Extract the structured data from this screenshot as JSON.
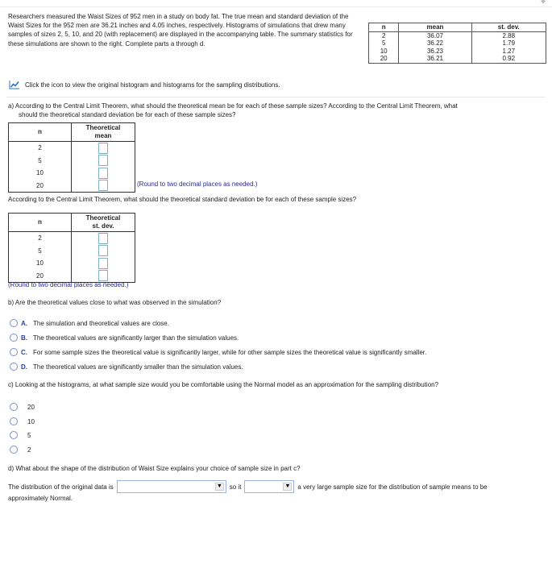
{
  "header": {
    "expand_icon": "expand-icon"
  },
  "intro": {
    "text": "Researchers measured the Waist Sizes of 952 men in a study on body fat. The true mean and standard deviation of the Waist Sizes for the 952 men are 36.21 inches and 4.05 inches, respectively. Histograms of simulations that drew many samples of sizes 2, 5, 10, and 20 (with replacement) are displayed in the accompanying table. The summary statistics for these simulations are shown to the right. Complete parts a through d."
  },
  "summary_table": {
    "headers": [
      "n",
      "mean",
      "st. dev."
    ],
    "rows": [
      [
        "2",
        "36.07",
        "2.88"
      ],
      [
        "5",
        "36.22",
        "1.79"
      ],
      [
        "10",
        "36.23",
        "1.27"
      ],
      [
        "20",
        "36.21",
        "0.92"
      ]
    ]
  },
  "histogram_link": {
    "icon": "chart-icon",
    "text": "Click the icon to view the original histogram and histograms for the sampling distributions."
  },
  "part_a": {
    "question_line1": "a) According to the Central Limit Theorem, what should the theoretical mean be for each of these sample sizes? According to the Central Limit Theorem, what",
    "question_line2": "should the theoretical standard deviation be for each of these sample sizes?",
    "mean_table": {
      "header_n": "n",
      "header_value_line1": "Theoretical",
      "header_value_line2": "mean",
      "n_values": [
        "2",
        "5",
        "10",
        "20"
      ],
      "answers": [
        "",
        "",
        "",
        ""
      ]
    },
    "round_note_1": "(Round to two decimal places as needed.)",
    "sd_question": "According to the Central Limit Theorem, what should the theoretical standard deviation be for each of these sample sizes?",
    "sd_table": {
      "header_n": "n",
      "header_value_line1": "Theoretical",
      "header_value_line2": "st. dev.",
      "n_values": [
        "2",
        "5",
        "10",
        "20"
      ],
      "answers": [
        "",
        "",
        "",
        ""
      ]
    },
    "round_note_2": "(Round to two decimal places as needed.)"
  },
  "part_b": {
    "question": "b) Are the theoretical values close to what was observed in the simulation?",
    "options": [
      {
        "letter": "A.",
        "text": "The simulation and theoretical values are close."
      },
      {
        "letter": "B.",
        "text": "The theoretical values are significantly larger than the simulation values."
      },
      {
        "letter": "C.",
        "text": "For some sample sizes the theoretical value is significantly larger, while for other sample sizes the theoretical value is significantly smaller."
      },
      {
        "letter": "D.",
        "text": "The theoretical values are significantly smaller than the simulation values."
      }
    ]
  },
  "part_c": {
    "question": "c) Looking at the histograms, at what sample size would you be comfortable using the Normal model as an approximation for the sampling distribution?",
    "options": [
      "20",
      "10",
      "5",
      "2"
    ]
  },
  "part_d": {
    "question": "d) What about the shape of the distribution of Waist Size explains your choice of sample size in part c?",
    "text_before": "The distribution of the original data is",
    "select1_value": "",
    "text_middle": "so it",
    "select2_value": "",
    "text_after": "a very large sample size for the distribution of sample means to be",
    "text_line2": "approximately Normal.",
    "dropdown_icon": "▼"
  },
  "colors": {
    "accent_blue": "#2a3fa8",
    "note_blue": "#2a2aa0",
    "input_border": "#7fb0c8"
  }
}
